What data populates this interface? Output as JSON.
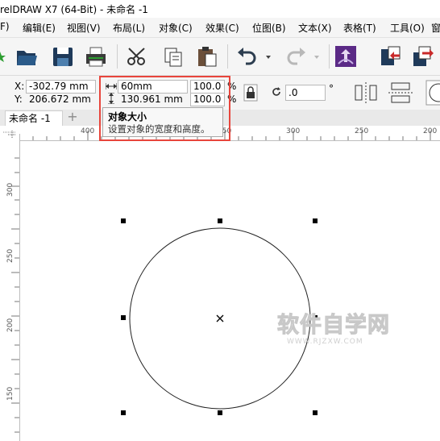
{
  "window": {
    "title": "relDRAW X7 (64-Bit) - 未命名 -1"
  },
  "menu": [
    "F)",
    "编辑(E)",
    "视图(V)",
    "布局(L)",
    "对象(C)",
    "效果(C)",
    "位图(B)",
    "文本(X)",
    "表格(T)",
    "工具(O)",
    "窗"
  ],
  "toolbar": {
    "icons": [
      "star-icon",
      "open-folder-icon",
      "save-icon",
      "print-icon",
      "cut-icon",
      "copy-icon",
      "paste-icon",
      "undo-icon",
      "dropdown-arrow-icon",
      "redo-icon",
      "dropdown-arrow-icon",
      "corel-connect-icon",
      "import-icon",
      "export-icon"
    ]
  },
  "propbar": {
    "x_label": "X:",
    "x_value": "-302.79 mm",
    "y_label": "Y:",
    "y_value": "206.672 mm",
    "width_value": "60mm",
    "height_value": "130.961 mm",
    "scale_x": "100.0",
    "scale_y": "100.0",
    "percent": "%",
    "rotation_value": ".0",
    "degree": "°"
  },
  "tabs": {
    "doc_tab": "未命名 -1",
    "add_tab": "+"
  },
  "tooltip": {
    "title": "对象大小",
    "description": "设置对象的宽度和高度。"
  },
  "rulers": {
    "h_ticks": [
      "400",
      "150",
      "300",
      "250",
      "200"
    ],
    "v_ticks": [
      "300",
      "250",
      "200",
      "150"
    ]
  },
  "watermark": {
    "text": "软件自学网",
    "sub": "WWW.RJZXW.COM"
  },
  "accent_color": "#e8453c"
}
